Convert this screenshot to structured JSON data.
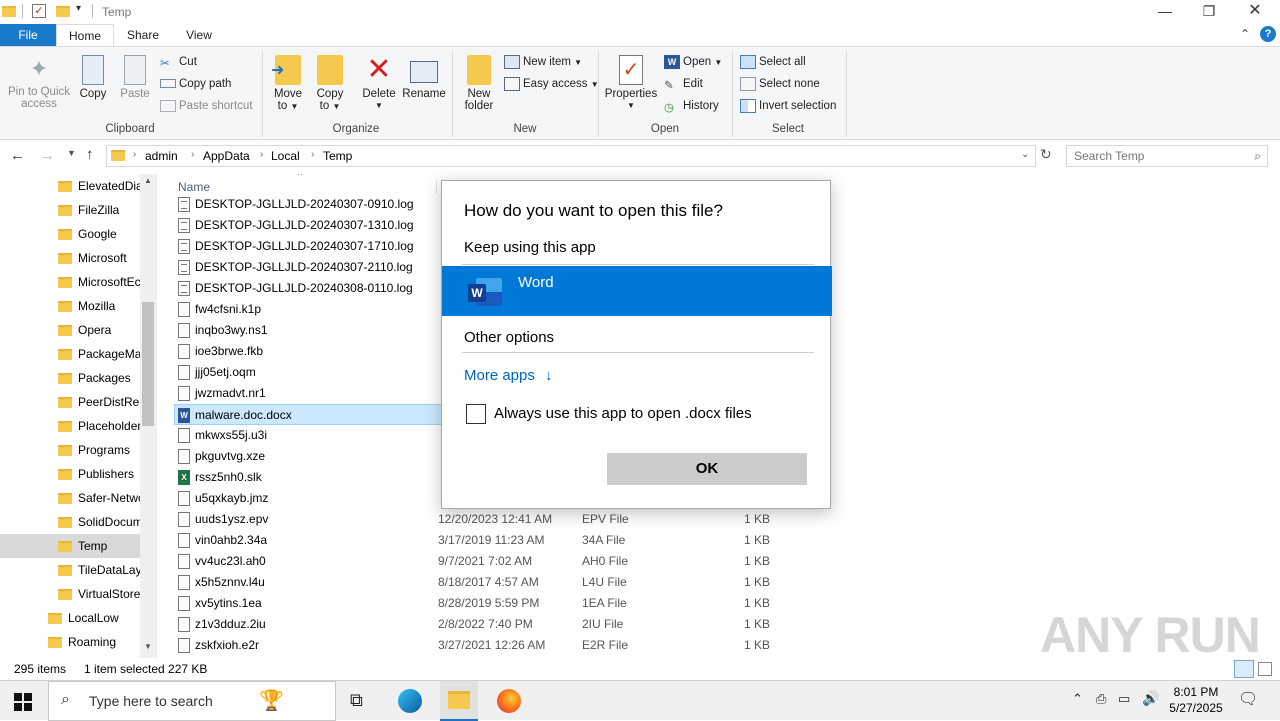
{
  "window": {
    "title": "Temp"
  },
  "tabs": [
    "File",
    "Home",
    "Share",
    "View"
  ],
  "ribbon": {
    "clipboard": {
      "pin": "Pin to Quick\naccess",
      "pin_l1": "Pin to Quick",
      "pin_l2": "access",
      "copy": "Copy",
      "paste": "Paste",
      "cut": "Cut",
      "copy_path": "Copy path",
      "paste_shortcut": "Paste shortcut",
      "group": "Clipboard"
    },
    "organize": {
      "move_l1": "Move",
      "move_l2": "to",
      "copy_l1": "Copy",
      "copy_l2": "to",
      "delete": "Delete",
      "rename": "Rename",
      "group": "Organize"
    },
    "new": {
      "folder_l1": "New",
      "folder_l2": "folder",
      "new_item": "New item",
      "easy_access": "Easy access",
      "group": "New"
    },
    "open": {
      "properties": "Properties",
      "open": "Open",
      "edit": "Edit",
      "history": "History",
      "group": "Open"
    },
    "select": {
      "select_all": "Select all",
      "select_none": "Select none",
      "invert": "Invert selection",
      "group": "Select"
    }
  },
  "address": {
    "crumbs": [
      "admin",
      "AppData",
      "Local",
      "Temp"
    ],
    "search_placeholder": "Search Temp"
  },
  "nav": {
    "items": [
      {
        "label": "ElevatedDia"
      },
      {
        "label": "FileZilla"
      },
      {
        "label": "Google"
      },
      {
        "label": "Microsoft"
      },
      {
        "label": "MicrosoftEc"
      },
      {
        "label": "Mozilla"
      },
      {
        "label": "Opera"
      },
      {
        "label": "PackageMa"
      },
      {
        "label": "Packages"
      },
      {
        "label": "PeerDistRep"
      },
      {
        "label": "Placeholder"
      },
      {
        "label": "Programs"
      },
      {
        "label": "Publishers"
      },
      {
        "label": "Safer-Netwo"
      },
      {
        "label": "SolidDocum"
      },
      {
        "label": "Temp"
      },
      {
        "label": "TileDataLay"
      },
      {
        "label": "VirtualStore"
      },
      {
        "label": "LocalLow"
      },
      {
        "label": "Roaming"
      }
    ]
  },
  "list": {
    "header_name": "Name",
    "files": [
      {
        "name": "DESKTOP-JGLLJLD-20240307-0910.log",
        "date": "",
        "type": "",
        "size": ""
      },
      {
        "name": "DESKTOP-JGLLJLD-20240307-1310.log",
        "date": "",
        "type": "",
        "size": ""
      },
      {
        "name": "DESKTOP-JGLLJLD-20240307-1710.log",
        "date": "",
        "type": "",
        "size": ""
      },
      {
        "name": "DESKTOP-JGLLJLD-20240307-2110.log",
        "date": "",
        "type": "",
        "size": ""
      },
      {
        "name": "DESKTOP-JGLLJLD-20240308-0110.log",
        "date": "",
        "type": "",
        "size": ""
      },
      {
        "name": "fw4cfsni.k1p",
        "date": "",
        "type": "",
        "size": ""
      },
      {
        "name": "inqbo3wy.ns1",
        "date": "",
        "type": "",
        "size": ""
      },
      {
        "name": "ioe3brwe.fkb",
        "date": "",
        "type": "",
        "size": ""
      },
      {
        "name": "jjj05etj.oqm",
        "date": "",
        "type": "",
        "size": ""
      },
      {
        "name": "jwzmadvt.nr1",
        "date": "",
        "type": "",
        "size": ""
      },
      {
        "name": "malware.doc.docx",
        "date": "",
        "type": "",
        "size": ""
      },
      {
        "name": "mkwxs55j.u3i",
        "date": "",
        "type": "",
        "size": ""
      },
      {
        "name": "pkguvtvg.xze",
        "date": "",
        "type": "",
        "size": ""
      },
      {
        "name": "rssz5nh0.slk",
        "date": "",
        "type": "",
        "size": ""
      },
      {
        "name": "u5qxkayb.jmz",
        "date": "",
        "type": "",
        "size": ""
      },
      {
        "name": "uuds1ysz.epv",
        "date": "12/20/2023 12:41 AM",
        "type": "EPV File",
        "size": "1 KB"
      },
      {
        "name": "vin0ahb2.34a",
        "date": "3/17/2019 11:23 AM",
        "type": "34A File",
        "size": "1 KB"
      },
      {
        "name": "vv4uc23l.ah0",
        "date": "9/7/2021 7:02 AM",
        "type": "AH0 File",
        "size": "1 KB"
      },
      {
        "name": "x5h5znnv.l4u",
        "date": "8/18/2017 4:57 AM",
        "type": "L4U File",
        "size": "1 KB"
      },
      {
        "name": "xv5ytins.1ea",
        "date": "8/28/2019 5:59 PM",
        "type": "1EA File",
        "size": "1 KB"
      },
      {
        "name": "z1v3dduz.2iu",
        "date": "2/8/2022 7:40 PM",
        "type": "2IU File",
        "size": "1 KB"
      },
      {
        "name": "zskfxioh.e2r",
        "date": "3/27/2021 12:26 AM",
        "type": "E2R File",
        "size": "1 KB"
      }
    ]
  },
  "status": {
    "count": "295 items",
    "selected": "1 item selected  227 KB"
  },
  "dialog": {
    "title": "How do you want to open this file?",
    "keep_using": "Keep using this app",
    "app_name": "Word",
    "other_options": "Other options",
    "more_apps": "More apps",
    "always_label": "Always use this app to open .docx files",
    "ok": "OK"
  },
  "taskbar": {
    "search_placeholder": "Type here to search",
    "time": "8:01 PM",
    "date": "5/27/2025"
  },
  "watermark": "ANY RUN",
  "colors": {
    "accent": "#0078d7",
    "file_tab": "#1979ca",
    "selection": "#cce8ff"
  }
}
